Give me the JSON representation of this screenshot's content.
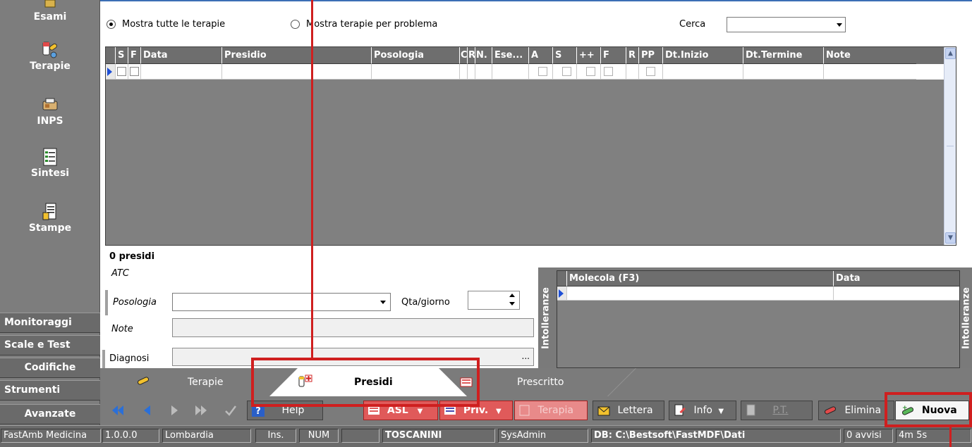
{
  "sidebar": {
    "items": [
      {
        "label": "Esami",
        "icon": "exam-icon"
      },
      {
        "label": "Terapie",
        "icon": "therapy-icon"
      },
      {
        "label": "INPS",
        "icon": "inps-icon"
      },
      {
        "label": "Sintesi",
        "icon": "summary-icon"
      },
      {
        "label": "Stampe",
        "icon": "print-icon"
      }
    ],
    "bottom_buttons": [
      "Monitoraggi",
      "Scale e Test",
      "Codifiche",
      "Strumenti",
      "Avanzate"
    ]
  },
  "options": {
    "radio_all": "Mostra tutte le terapie",
    "radio_problem": "Mostra terapie per problema",
    "search_label": "Cerca",
    "search_value": ""
  },
  "grid": {
    "columns": [
      "S",
      "F",
      "Data",
      "Presidio",
      "Posologia",
      "C",
      "R",
      "N.",
      "Ese...",
      "A",
      "S",
      "++",
      "F",
      "R",
      "PP",
      "Dt.Inizio",
      "Dt.Termine",
      "Note"
    ]
  },
  "detail": {
    "count": "0 presidi",
    "atc_label": "ATC",
    "posologia_label": "Posologia",
    "qta_label": "Qta/giorno",
    "note_label": "Note",
    "diagnosi_label": "Diagnosi",
    "ellipsis": "..."
  },
  "intolleranze": {
    "side_label": "Intolleranze",
    "columns": [
      "Molecola  (F3)",
      "Data"
    ]
  },
  "tabs": [
    {
      "label": "Terapie",
      "active": false
    },
    {
      "label": "Presidi",
      "active": true
    },
    {
      "label": "Prescritto",
      "active": false
    }
  ],
  "toolbar": {
    "help": "Help",
    "asl": "ASL",
    "priv": "Priv.",
    "terapia": "Terapia",
    "lettera": "Lettera",
    "info": "Info",
    "pt": "P.T.",
    "elimina": "Elimina",
    "nuova": "Nuova"
  },
  "status": {
    "app": "FastAmb Medicina",
    "version": "1.0.0.0",
    "region": "Lombardia",
    "ins": "Ins.",
    "num": "NUM",
    "empty": "",
    "doctor": "TOSCANINI",
    "user": "SysAdmin",
    "db": "DB: C:\\Bestsoft\\FastMDF\\Dati",
    "avvisi": "0 avvisi",
    "timer": "4m 5s"
  },
  "colors": {
    "sidebar_bg": "#7d7d7d",
    "toolbar_bg": "#7b7b7b",
    "alert_red": "#e05a5a",
    "annotation_red": "#cf1f1f",
    "row_pointer_blue": "#1e4fd6"
  }
}
